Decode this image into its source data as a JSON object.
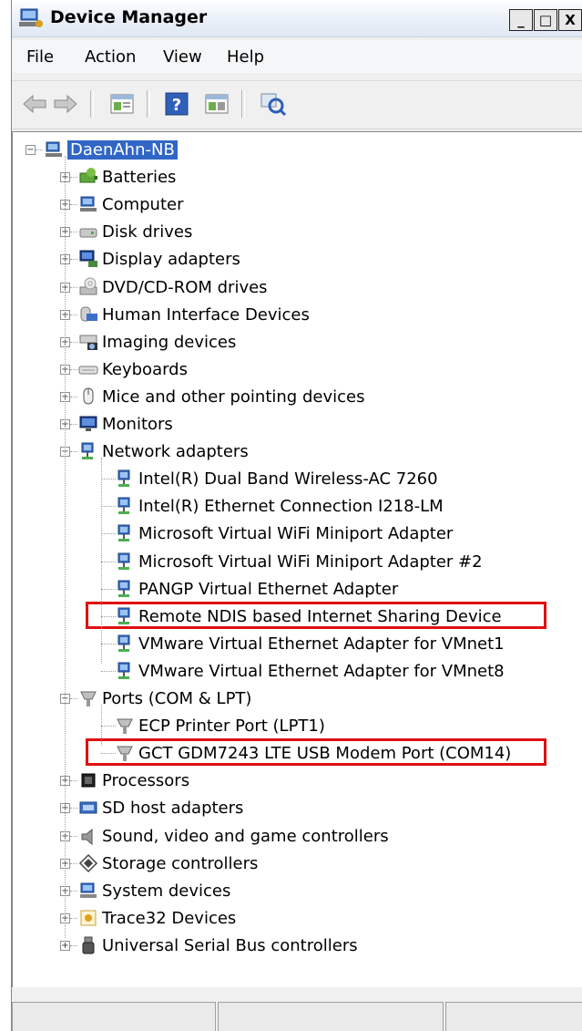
{
  "window": {
    "title": "Device Manager",
    "buttons": [
      "_",
      "□",
      "X"
    ]
  },
  "menu": [
    "File",
    "Action",
    "View",
    "Help"
  ],
  "toolbar": {
    "back": "back-arrow-icon",
    "forward": "forward-arrow-icon",
    "properties": "properties-icon",
    "help": "help-icon",
    "update": "update-driver-icon",
    "scan": "scan-hardware-icon"
  },
  "tree": {
    "root": "DaenAhn-NB",
    "categories": [
      "Batteries",
      "Computer",
      "Disk drives",
      "Display adapters",
      "DVD/CD-ROM drives",
      "Human Interface Devices",
      "Imaging devices",
      "Keyboards",
      "Mice and other pointing devices",
      "Monitors",
      "Network adapters"
    ],
    "network_adapters": [
      "Intel(R) Dual Band Wireless-AC 7260",
      "Intel(R) Ethernet Connection I218-LM",
      "Microsoft Virtual WiFi Miniport Adapter",
      "Microsoft Virtual WiFi Miniport Adapter #2",
      "PANGP Virtual Ethernet Adapter",
      "Remote NDIS based Internet Sharing Device",
      "VMware Virtual Ethernet Adapter for VMnet1",
      "VMware Virtual Ethernet Adapter for VMnet8"
    ],
    "ports": "Ports (COM & LPT)",
    "port_items": [
      "ECP Printer Port (LPT1)",
      "GCT GDM7243 LTE USB Modem Port (COM14)"
    ],
    "categories_after": [
      "Processors",
      "SD host adapters",
      "Sound, video and game controllers",
      "Storage controllers",
      "System devices",
      "Trace32 Devices",
      "Universal Serial Bus controllers"
    ]
  },
  "highlight_color": "#e01010",
  "selection_color": "#3166c6"
}
